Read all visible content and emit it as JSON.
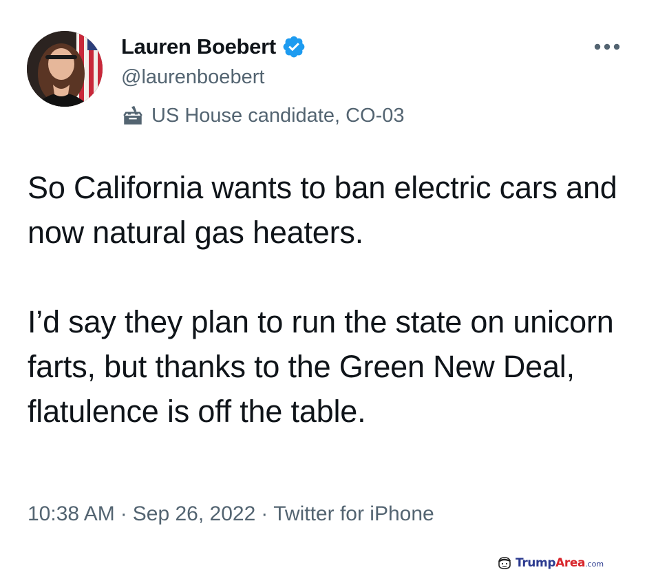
{
  "author": {
    "display_name": "Lauren Boebert",
    "handle": "@laurenboebert",
    "label": "US House candidate, CO-03",
    "verified": true,
    "label_icon": "ballot-box-icon"
  },
  "tweet": {
    "paragraphs": [
      "So California wants to ban electric cars and now natural gas heaters.",
      "I’d say they plan to run the state on unicorn farts, but thanks to the Green New Deal, flatulence is off the table."
    ]
  },
  "meta": {
    "time": "10:38 AM",
    "separator": "·",
    "date": "Sep 26, 2022",
    "source": "Twitter for iPhone"
  },
  "watermark": {
    "part1": "Trump",
    "part2": "Area",
    "part3": ".com"
  },
  "colors": {
    "text_primary": "#0f1419",
    "text_secondary": "#536471",
    "verified_blue": "#1d9bf0",
    "background": "#ffffff"
  }
}
